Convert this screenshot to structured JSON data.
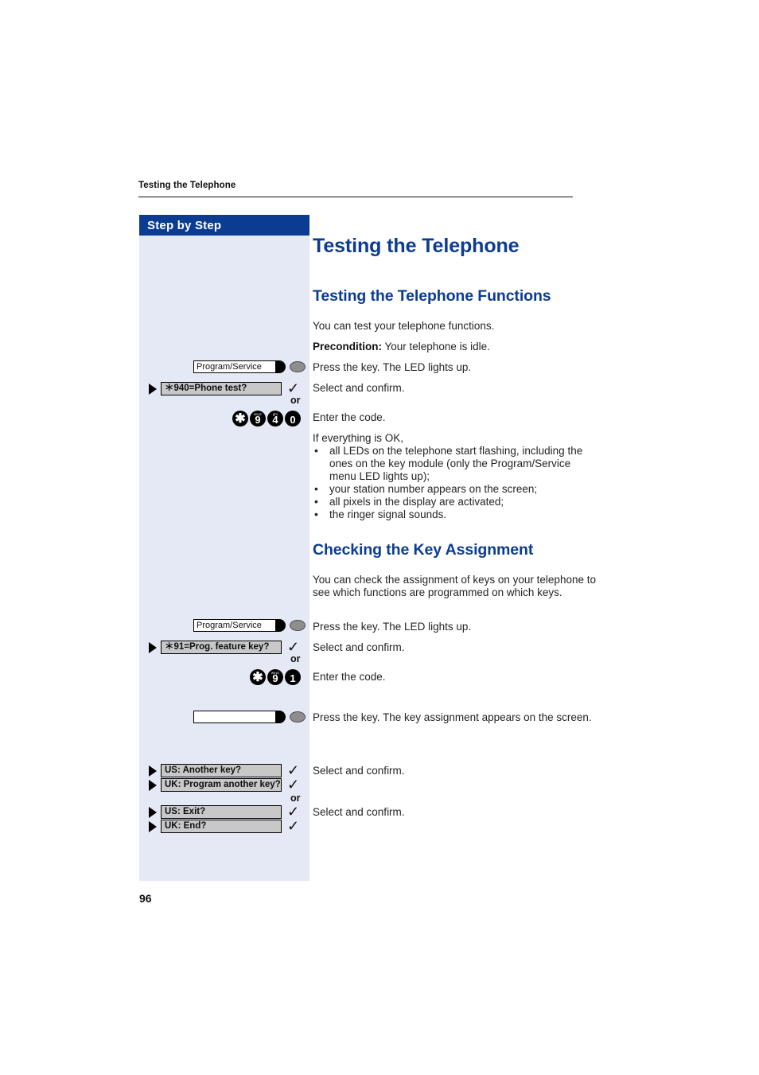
{
  "page": {
    "running_header": "Testing the Telephone",
    "page_number": "96",
    "accent_color": "#0b3c91",
    "sidebar_bg": "#e4e9f5",
    "display_bar_bg": "#c8c8c8"
  },
  "sidebar": {
    "title": "Step by Step"
  },
  "main": {
    "h1": "Testing the Telephone",
    "section1": {
      "h2": "Testing the Telephone Functions",
      "intro": "You can test your telephone functions.",
      "precondition_label": "Precondition:",
      "precondition_text": " Your telephone is idle.",
      "press_key": "Press the key. The LED lights up.",
      "select_confirm": "Select and confirm.",
      "enter_code": "Enter the code.",
      "result_intro": "If everything is OK,",
      "results": [
        "all LEDs on the telephone start flashing, including the ones on the key module (only the Program/Service menu LED lights up);",
        "your station number appears on the screen;",
        "all pixels in the display are activated;",
        "the ringer signal sounds."
      ]
    },
    "section2": {
      "h2": "Checking the Key Assignment",
      "intro": "You can check the assignment of keys on your telephone to see which functions are programmed on which keys.",
      "press_key": "Press the key. The LED lights up.",
      "select_confirm_1": "Select and confirm.",
      "enter_code": "Enter the code.",
      "press_key_2": "Press the key. The key assignment appears on the screen.",
      "select_confirm_2": "Select and confirm.",
      "select_confirm_3": "Select and confirm."
    }
  },
  "icons": {
    "or_label": "or",
    "check_glyph": "✓",
    "hardkey_1": {
      "label": "Program/Service"
    },
    "hardkey_2": {
      "label": "Program/Service"
    },
    "hardkey_3": {
      "label": ""
    },
    "display_1": {
      "text": "＊940=Phone test?"
    },
    "display_2": {
      "text": "＊91=Prog. feature key?"
    },
    "display_3": {
      "text": "US: Another key?"
    },
    "display_4": {
      "text": "UK: Program another key?"
    },
    "display_5": {
      "text": "US: Exit?"
    },
    "display_6": {
      "text": "UK: End?"
    },
    "keypad_1": [
      {
        "digit": "✱",
        "letters": ""
      },
      {
        "digit": "9",
        "letters": "wxyz"
      },
      {
        "digit": "4",
        "letters": "ghi"
      },
      {
        "digit": "0",
        "letters": ""
      }
    ],
    "keypad_2": [
      {
        "digit": "✱",
        "letters": ""
      },
      {
        "digit": "9",
        "letters": "wxyz"
      },
      {
        "digit": "1",
        "letters": ""
      }
    ]
  }
}
